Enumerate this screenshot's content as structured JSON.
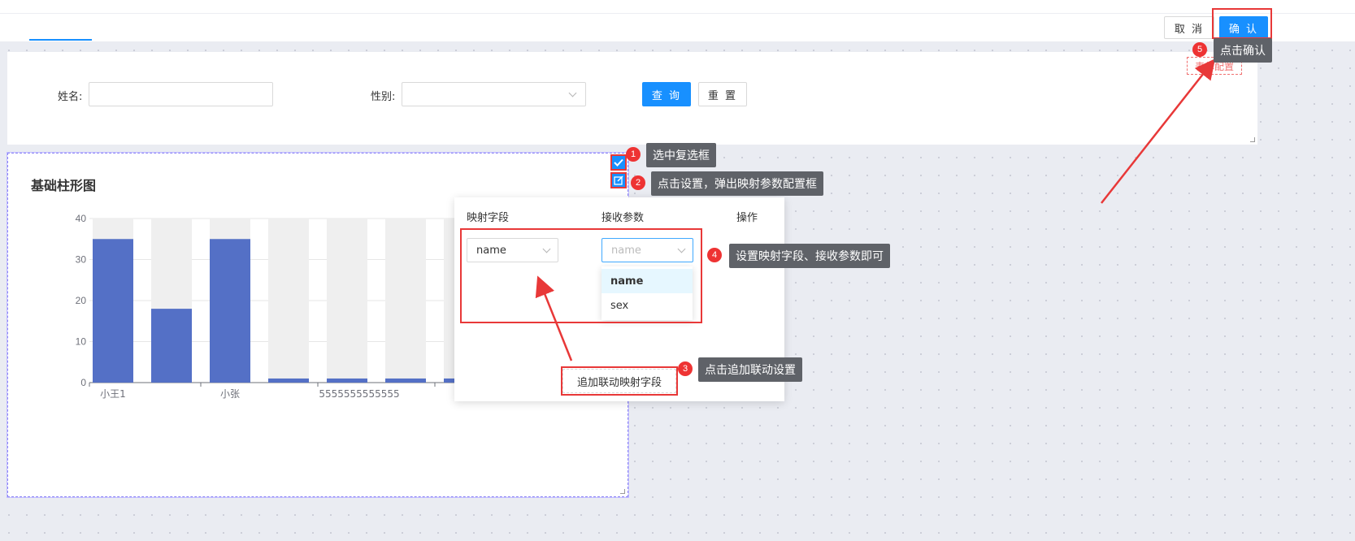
{
  "toolbar": {
    "cancel_label": "取 消",
    "confirm_label": "确 认"
  },
  "query_form": {
    "name_label": "姓名:",
    "name_value": "",
    "sex_label": "性别:",
    "sex_value": "",
    "query_label": "查 询",
    "reset_label": "重 置",
    "form_config_label": "表单配置"
  },
  "chart_panel": {
    "title": "基础柱形图"
  },
  "chart_data": {
    "type": "bar",
    "title": "基础柱形图",
    "categories": [
      "小王1",
      "",
      "小张",
      "",
      "5555555555555",
      "",
      ""
    ],
    "x_tick_labels": [
      "小王1",
      "小张",
      "5555555555555"
    ],
    "values": [
      35,
      18,
      35,
      1,
      1,
      1,
      1
    ],
    "ylim": [
      0,
      40
    ],
    "y_ticks": [
      0,
      10,
      20,
      30,
      40
    ],
    "bar_color": "#5470c6",
    "background_bar_color": "#efefef",
    "grid": true
  },
  "mapping_popover": {
    "col_field": "映射字段",
    "col_param": "接收参数",
    "col_action": "操作",
    "field_value": "name",
    "param_placeholder": "name",
    "options": [
      "name",
      "sex"
    ],
    "add_label": "追加联动映射字段"
  },
  "steps": [
    {
      "num": "1",
      "text": "选中复选框"
    },
    {
      "num": "2",
      "text": "点击设置，弹出映射参数配置框"
    },
    {
      "num": "3",
      "text": "点击追加联动设置"
    },
    {
      "num": "4",
      "text": "设置映射字段、接收参数即可"
    },
    {
      "num": "5",
      "text": "点击确认"
    }
  ],
  "colors": {
    "primary": "#1890ff",
    "annotation_red": "#e83838",
    "tooltip_bg": "#5f6268"
  }
}
